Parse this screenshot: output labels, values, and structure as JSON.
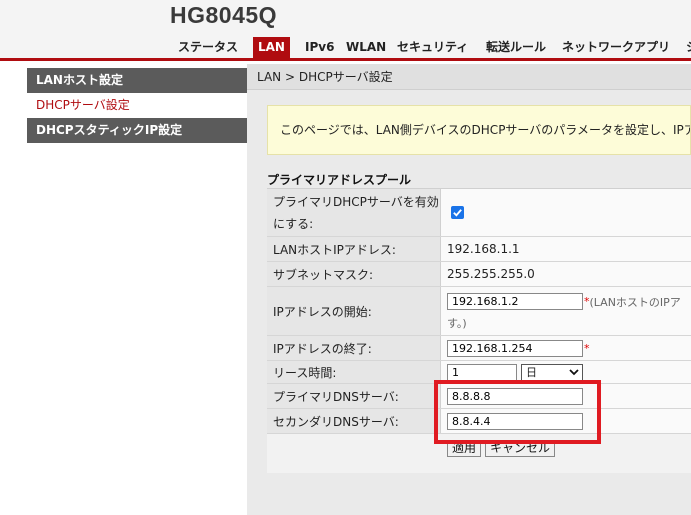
{
  "header": {
    "brand": "HG8045Q",
    "tabs": [
      {
        "label": "ステータス"
      },
      {
        "label": "LAN"
      },
      {
        "label": "IPv6"
      },
      {
        "label": "WLAN"
      },
      {
        "label": "セキュリティ"
      },
      {
        "label": "転送ルール"
      },
      {
        "label": "ネットワークアプリ"
      },
      {
        "label": "シ"
      }
    ],
    "active_tab": "LAN"
  },
  "sidebar": {
    "items": [
      {
        "label": "LANホスト設定"
      },
      {
        "label": "DHCPサーバ設定"
      },
      {
        "label": "DHCPスタティックIP設定"
      }
    ],
    "active_item": "DHCPサーバ設定"
  },
  "breadcrumb": "LAN > DHCPサーバ設定",
  "notice": "このページでは、LAN側デバイスのDHCPサーバのパラメータを設定し、IPアドレスを",
  "section_title": "プライマリアドレスプール",
  "form": {
    "enable_label_line1": "プライマリDHCPサーバを有効",
    "enable_label_line2": "にする:",
    "enable_checked": true,
    "lan_ip_label": "LANホストIPアドレス:",
    "lan_ip_value": "192.168.1.1",
    "subnet_label": "サブネットマスク:",
    "subnet_value": "255.255.255.0",
    "start_label": "IPアドレスの開始:",
    "start_value": "192.168.1.2",
    "start_note_line1": "(LANホストのIPア",
    "start_note_line2": "す。)",
    "end_label": "IPアドレスの終了:",
    "end_value": "192.168.1.254",
    "lease_label": "リース時間:",
    "lease_value": "1",
    "lease_unit": "日",
    "dns1_label": "プライマリDNSサーバ:",
    "dns1_value": "8.8.8.8",
    "dns2_label": "セカンダリDNSサーバ:",
    "dns2_value": "8.8.4.4",
    "required_mark": "*"
  },
  "buttons": {
    "apply": "適用",
    "cancel": "キャンセル"
  },
  "colors": {
    "accent": "#b00c10",
    "highlight": "#e01b22",
    "checkbox": "#1a73e8"
  }
}
